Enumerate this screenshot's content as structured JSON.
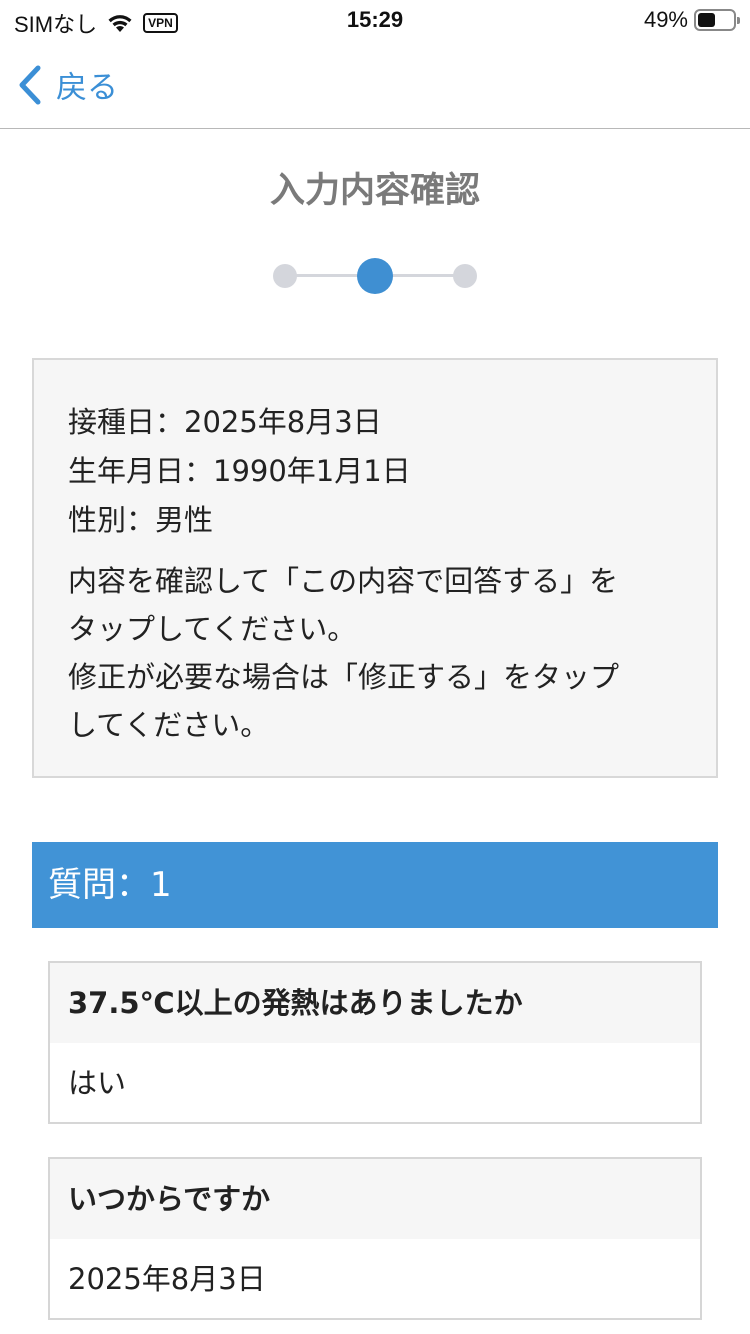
{
  "status_bar": {
    "carrier": "SIMなし",
    "vpn": "VPN",
    "time": "15:29",
    "battery_percent": "49%",
    "battery_level": 0.49
  },
  "nav": {
    "back_label": "戻る"
  },
  "page": {
    "title": "入力内容確認",
    "steps_total": 3,
    "current_step": 2
  },
  "info": {
    "vaccination_date": "接種日：2025年8月3日",
    "birth_date": "生年月日：1990年1月1日",
    "gender": "性別：男性",
    "message_line1": "内容を確認して「この内容で回答する」を",
    "message_line2": "タップしてください。",
    "message_line3": "修正が必要な場合は「修正する」をタップ",
    "message_line4": "してください。"
  },
  "question_section": {
    "header": "質問：1",
    "items": [
      {
        "question": "37.5℃以上の発熱はありましたか",
        "answer": "はい"
      },
      {
        "question": "いつからですか",
        "answer": "2025年8月3日"
      }
    ]
  },
  "colors": {
    "accent": "#4193d6",
    "back_link": "#3b8fd6",
    "title_gray": "#7a7a7a",
    "step_inactive": "#d4d6dc"
  }
}
